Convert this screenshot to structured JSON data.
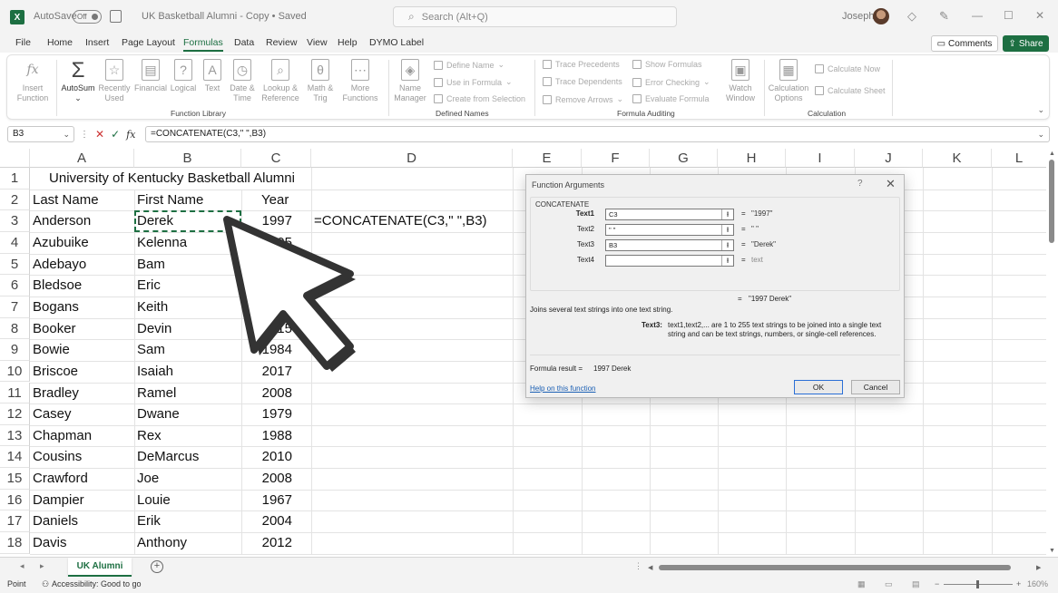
{
  "titlebar": {
    "logo": "X",
    "autosave_label": "AutoSave",
    "autosave_state": "Off",
    "doc_title": "UK Basketball Alumni - Copy • Saved",
    "search_placeholder": "Search (Alt+Q)",
    "user_name": "Joseph"
  },
  "menu": {
    "tabs": [
      "File",
      "Home",
      "Insert",
      "Page Layout",
      "Formulas",
      "Data",
      "Review",
      "View",
      "Help",
      "DYMO Label"
    ],
    "active": "Formulas",
    "comments_label": "Comments",
    "share_label": "Share"
  },
  "ribbon": {
    "function_library": {
      "label": "Function Library",
      "insert_function": [
        "Insert",
        "Function"
      ],
      "autosum": "AutoSum",
      "recently_used": [
        "Recently",
        "Used"
      ],
      "financial": "Financial",
      "logical": "Logical",
      "text": "Text",
      "date_time": [
        "Date &",
        "Time"
      ],
      "lookup": [
        "Lookup &",
        "Reference"
      ],
      "math": [
        "Math &",
        "Trig"
      ],
      "more": [
        "More",
        "Functions"
      ]
    },
    "defined_names": {
      "label": "Defined Names",
      "name_manager": [
        "Name",
        "Manager"
      ],
      "define_name": "Define Name",
      "use_in_formula": "Use in Formula",
      "create_from_selection": "Create from Selection"
    },
    "formula_auditing": {
      "label": "Formula Auditing",
      "trace_precedents": "Trace Precedents",
      "trace_dependents": "Trace Dependents",
      "remove_arrows": "Remove Arrows",
      "show_formulas": "Show Formulas",
      "error_checking": "Error Checking",
      "evaluate_formula": "Evaluate Formula",
      "watch_window": [
        "Watch",
        "Window"
      ]
    },
    "calculation": {
      "label": "Calculation",
      "calc_options": [
        "Calculation",
        "Options"
      ],
      "calc_now": "Calculate Now",
      "calc_sheet": "Calculate Sheet"
    }
  },
  "formula_bar": {
    "name_box": "B3",
    "formula": "=CONCATENATE(C3,\" \",B3)"
  },
  "grid": {
    "columns": [
      "A",
      "B",
      "C",
      "D",
      "E",
      "F",
      "G",
      "H",
      "I",
      "J",
      "K",
      "L"
    ],
    "rows": [
      "1",
      "2",
      "3",
      "4",
      "5",
      "6",
      "7",
      "8",
      "9",
      "10",
      "11",
      "12",
      "13",
      "14",
      "15",
      "16",
      "17",
      "18"
    ],
    "title": "University of Kentucky Basketball Alumni",
    "headers": [
      "Last Name",
      "First Name",
      "Year"
    ],
    "d3_formula": "=CONCATENATE(C3,\" \",B3)",
    "data": [
      [
        "Anderson",
        "Derek",
        "1997"
      ],
      [
        "Azubuike",
        "Kelenna",
        "2005"
      ],
      [
        "Adebayo",
        "Bam",
        ""
      ],
      [
        "Bledsoe",
        "Eric",
        ""
      ],
      [
        "Bogans",
        "Keith",
        ""
      ],
      [
        "Booker",
        "Devin",
        "2015"
      ],
      [
        "Bowie",
        "Sam",
        "1984"
      ],
      [
        "Briscoe",
        "Isaiah",
        "2017"
      ],
      [
        "Bradley",
        "Ramel",
        "2008"
      ],
      [
        "Casey",
        "Dwane",
        "1979"
      ],
      [
        "Chapman",
        "Rex",
        "1988"
      ],
      [
        "Cousins",
        "DeMarcus",
        "2010"
      ],
      [
        "Crawford",
        "Joe",
        "2008"
      ],
      [
        "Dampier",
        "Louie",
        "1967"
      ],
      [
        "Daniels",
        "Erik",
        "2004"
      ],
      [
        "Davis",
        "Anthony",
        "2012"
      ]
    ]
  },
  "sheet_tabs": {
    "active": "UK Alumni",
    "add_label": "+"
  },
  "status": {
    "mode": "Point",
    "accessibility": "Accessibility: Good to go",
    "zoom": "160%"
  },
  "dialog": {
    "title": "Function Arguments",
    "help": "?",
    "close": "✕",
    "function_name": "CONCATENATE",
    "args": [
      {
        "label": "Text1",
        "value": "C3",
        "result": "\"1997\"",
        "bold": true
      },
      {
        "label": "Text2",
        "value": "\" \"",
        "result": "\" \"",
        "bold": false
      },
      {
        "label": "Text3",
        "value": "B3",
        "result": "\"Derek\"",
        "bold": false
      },
      {
        "label": "Text4",
        "value": "",
        "result": "text",
        "bold": false
      }
    ],
    "overall_result": "\"1997 Derek\"",
    "description": "Joins several text strings into one text string.",
    "param_name": "Text3:",
    "param_desc_1": "text1,text2,... are 1 to 255 text strings to be joined into a single text",
    "param_desc_2": "string and can be text strings, numbers, or single-cell references.",
    "formula_result_label": "Formula result =",
    "formula_result_value": "1997 Derek",
    "help_link": "Help on this function",
    "ok_label": "OK",
    "cancel_label": "Cancel"
  },
  "colors": {
    "accent": "#1d6f42",
    "link": "#1a5fb4"
  }
}
